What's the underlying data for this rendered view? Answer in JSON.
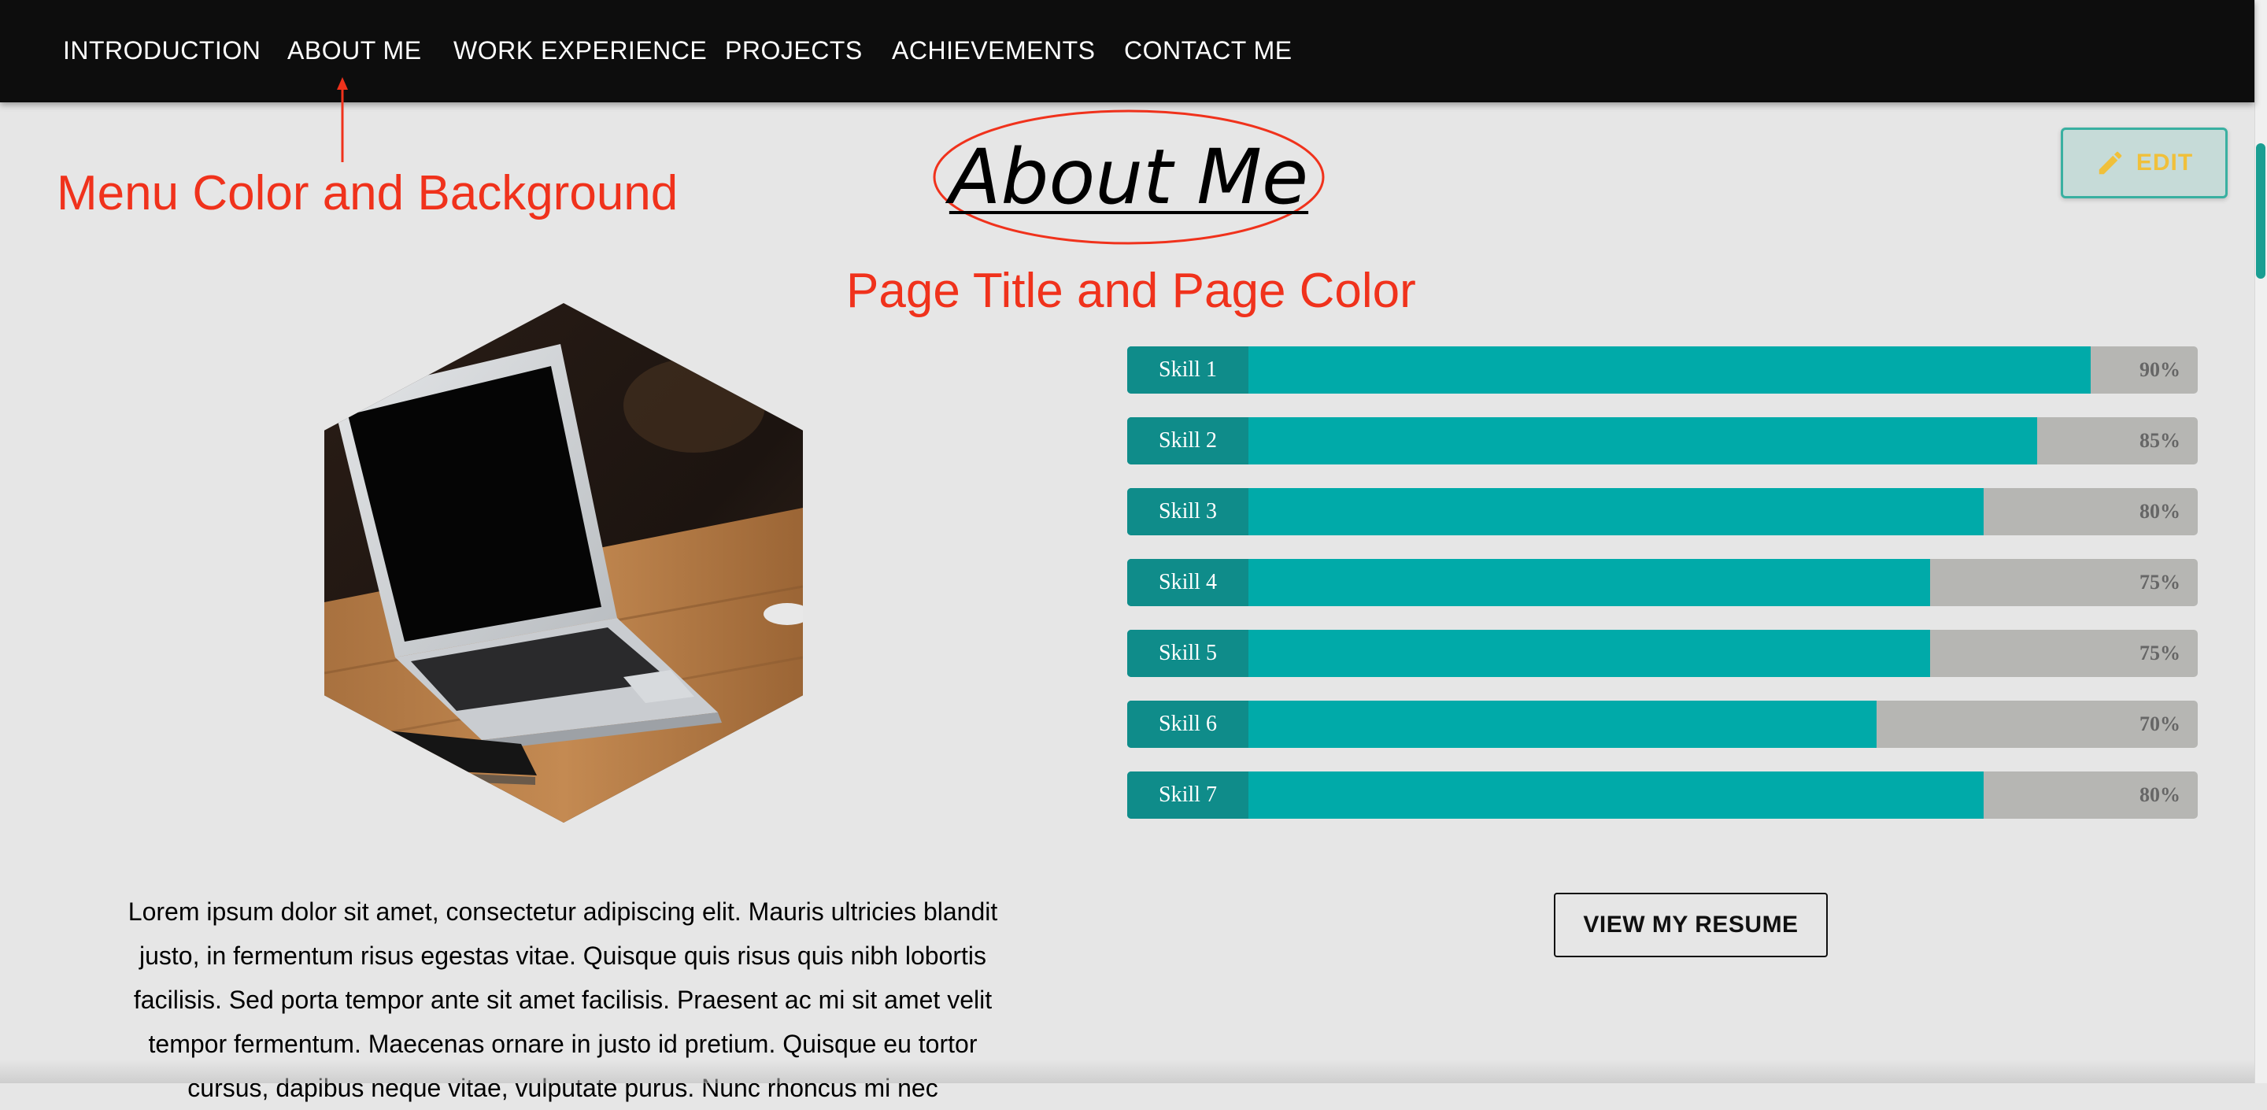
{
  "nav": {
    "items": [
      "INTRODUCTION",
      "ABOUT ME",
      "WORK EXPERIENCE",
      "PROJECTS",
      "ACHIEVEMENTS",
      "CONTACT ME"
    ],
    "background": "#0d0d0d",
    "text_color": "#ffffff"
  },
  "annotations": {
    "menu_note": "Menu Color and Background",
    "title_note": "Page Title and Page Color",
    "color": "#f0321c"
  },
  "page": {
    "title": "About Me",
    "background": "#e6e6e6"
  },
  "edit_button": {
    "label": "EDIT",
    "icon": "pencil-icon"
  },
  "skills": [
    {
      "label": "Skill 1",
      "percent": 90,
      "percent_label": "90%"
    },
    {
      "label": "Skill 2",
      "percent": 85,
      "percent_label": "85%"
    },
    {
      "label": "Skill 3",
      "percent": 80,
      "percent_label": "80%"
    },
    {
      "label": "Skill 4",
      "percent": 75,
      "percent_label": "75%"
    },
    {
      "label": "Skill 5",
      "percent": 75,
      "percent_label": "75%"
    },
    {
      "label": "Skill 6",
      "percent": 70,
      "percent_label": "70%"
    },
    {
      "label": "Skill 7",
      "percent": 80,
      "percent_label": "80%"
    }
  ],
  "skill_colors": {
    "fill": "#00aaa9",
    "label_bg": "#0f8c8a",
    "track": "#b6b6b3"
  },
  "resume_button": {
    "label": "VIEW MY RESUME"
  },
  "bio": {
    "text": "Lorem ipsum dolor sit amet, consectetur adipiscing elit. Mauris ultricies blandit justo, in fermentum risus egestas vitae. Quisque quis risus quis nibh lobortis facilisis. Sed porta tempor ante sit amet facilisis. Praesent ac mi sit amet velit tempor fermentum. Maecenas ornare in justo id pretium. Quisque eu tortor cursus, dapibus neque vitae, vulputate purus. Nunc rhoncus mi nec"
  },
  "profile_image": {
    "subject": "laptop-on-desk"
  },
  "scrollbar": {
    "thumb_color": "#1a9e92"
  }
}
